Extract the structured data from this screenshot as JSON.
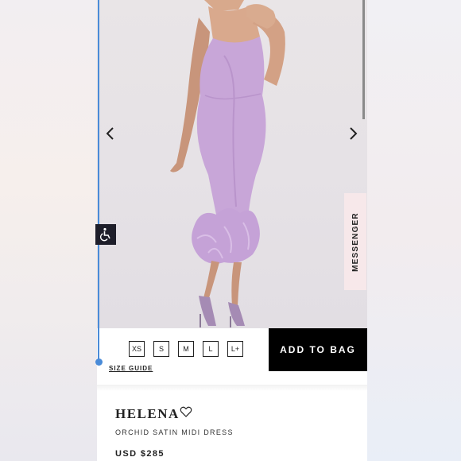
{
  "carousel": {
    "prev_icon": "chevron-left-icon",
    "next_icon": "chevron-right-icon"
  },
  "messenger": {
    "label": "MESSENGER"
  },
  "sizes": [
    "XS",
    "S",
    "M",
    "L",
    "L+"
  ],
  "add_to_bag": "ADD TO BAG",
  "size_guide": "SIZE GUIDE",
  "product": {
    "name": "HELENA",
    "subtitle": "ORCHID SATIN MIDI DRESS",
    "price": "USD $285",
    "favorite_icon": "heart-outline-icon"
  },
  "accessibility": {
    "icon": "wheelchair-icon",
    "accent_color": "#4a8bd8"
  },
  "colors": {
    "dress": "#c8a6d8",
    "bag_button": "#000000",
    "messenger_bg": "#f7e8ea"
  }
}
